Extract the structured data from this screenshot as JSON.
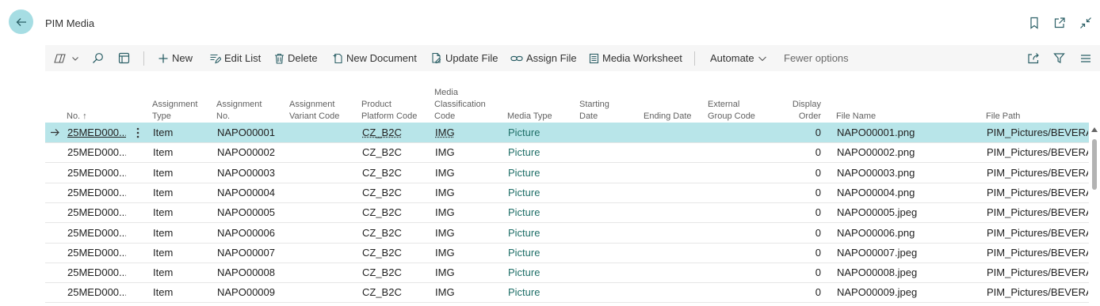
{
  "page": {
    "title": "PIM Media"
  },
  "actions": {
    "new": "New",
    "edit_list": "Edit List",
    "delete": "Delete",
    "new_document": "New Document",
    "update_file": "Update File",
    "assign_file": "Assign File",
    "media_worksheet": "Media Worksheet",
    "automate": "Automate",
    "fewer_options": "Fewer options"
  },
  "columns": {
    "no": "No. ↑",
    "assignment_type": "Assignment\nType",
    "assignment_no": "Assignment\nNo.",
    "assignment_variant_code": "Assignment\nVariant Code",
    "product_platform_code": "Product\nPlatform Code",
    "media_classification_code": "Media\nClassification\nCode",
    "media_type": "Media Type",
    "starting_date": "Starting\nDate",
    "ending_date": "Ending Date",
    "external_group_code": "External\nGroup Code",
    "display_order": "Display\nOrder",
    "file_name": "File Name",
    "file_path": "File Path"
  },
  "rows": [
    {
      "no": "25MED000...",
      "assignment_type": "Item",
      "assignment_no": "NAPO00001",
      "platform": "CZ_B2C",
      "classification": "IMG",
      "media_type": "Picture",
      "display_order": "0",
      "file_name": "NAPO00001.png",
      "file_path": "PIM_Pictures/BEVERAG"
    },
    {
      "no": "25MED000...",
      "assignment_type": "Item",
      "assignment_no": "NAPO00002",
      "platform": "CZ_B2C",
      "classification": "IMG",
      "media_type": "Picture",
      "display_order": "0",
      "file_name": "NAPO00002.png",
      "file_path": "PIM_Pictures/BEVERAG"
    },
    {
      "no": "25MED000...",
      "assignment_type": "Item",
      "assignment_no": "NAPO00003",
      "platform": "CZ_B2C",
      "classification": "IMG",
      "media_type": "Picture",
      "display_order": "0",
      "file_name": "NAPO00003.png",
      "file_path": "PIM_Pictures/BEVERAG"
    },
    {
      "no": "25MED000...",
      "assignment_type": "Item",
      "assignment_no": "NAPO00004",
      "platform": "CZ_B2C",
      "classification": "IMG",
      "media_type": "Picture",
      "display_order": "0",
      "file_name": "NAPO00004.png",
      "file_path": "PIM_Pictures/BEVERAG"
    },
    {
      "no": "25MED000...",
      "assignment_type": "Item",
      "assignment_no": "NAPO00005",
      "platform": "CZ_B2C",
      "classification": "IMG",
      "media_type": "Picture",
      "display_order": "0",
      "file_name": "NAPO00005.jpeg",
      "file_path": "PIM_Pictures/BEVERAG"
    },
    {
      "no": "25MED000...",
      "assignment_type": "Item",
      "assignment_no": "NAPO00006",
      "platform": "CZ_B2C",
      "classification": "IMG",
      "media_type": "Picture",
      "display_order": "0",
      "file_name": "NAPO00006.png",
      "file_path": "PIM_Pictures/BEVERAG"
    },
    {
      "no": "25MED000...",
      "assignment_type": "Item",
      "assignment_no": "NAPO00007",
      "platform": "CZ_B2C",
      "classification": "IMG",
      "media_type": "Picture",
      "display_order": "0",
      "file_name": "NAPO00007.jpeg",
      "file_path": "PIM_Pictures/BEVERAG"
    },
    {
      "no": "25MED000...",
      "assignment_type": "Item",
      "assignment_no": "NAPO00008",
      "platform": "CZ_B2C",
      "classification": "IMG",
      "media_type": "Picture",
      "display_order": "0",
      "file_name": "NAPO00008.jpeg",
      "file_path": "PIM_Pictures/BEVERAG"
    },
    {
      "no": "25MED000...",
      "assignment_type": "Item",
      "assignment_no": "NAPO00009",
      "platform": "CZ_B2C",
      "classification": "IMG",
      "media_type": "Picture",
      "display_order": "0",
      "file_name": "NAPO00009.jpeg",
      "file_path": "PIM_Pictures/BEVERAG"
    }
  ],
  "colors": {
    "accent": "#a6dde3",
    "selected_row": "#b8e5e9",
    "link": "#1f6f68"
  },
  "icons": [
    "back-arrow-icon",
    "bookmark-icon",
    "open-new-window-icon",
    "collapse-icon",
    "copilot-icon",
    "search-icon",
    "analysis-icon",
    "plus-icon",
    "edit-list-icon",
    "trash-icon",
    "new-document-icon",
    "update-file-icon",
    "link-icon",
    "worksheet-icon",
    "chevron-down-icon",
    "share-icon",
    "filter-icon",
    "list-icon",
    "row-arrow-icon",
    "row-menu-icon"
  ]
}
